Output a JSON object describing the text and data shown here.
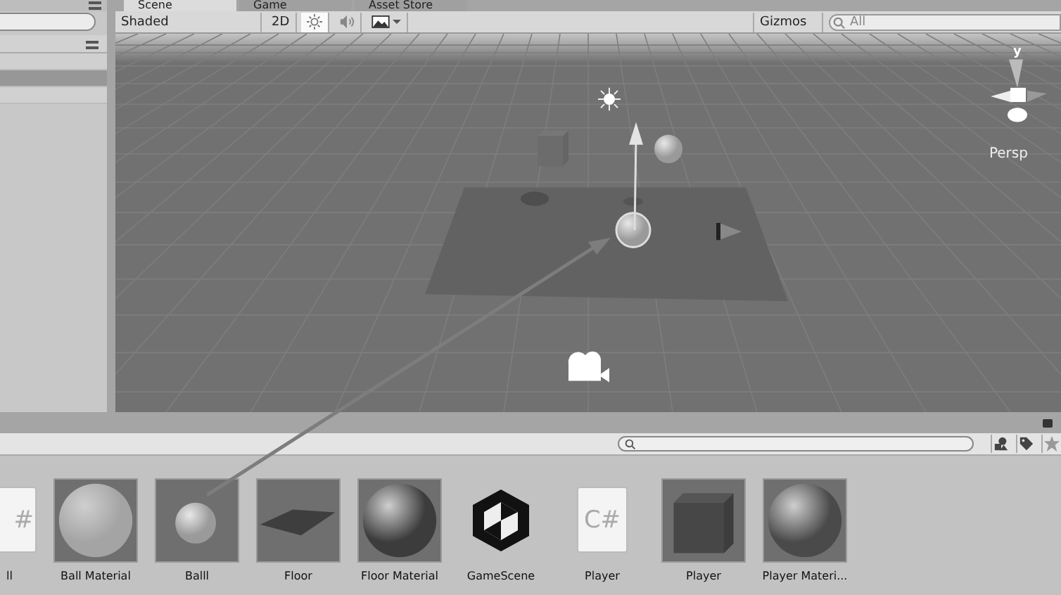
{
  "hierarchy": {
    "rows": [
      {
        "selected": false
      },
      {
        "selected": true
      },
      {
        "selected": false
      }
    ]
  },
  "tabs": [
    {
      "label": "Scene",
      "selected": true
    },
    {
      "label": "Game",
      "selected": false
    },
    {
      "label": "Asset Store",
      "selected": false
    }
  ],
  "scene_toolbar": {
    "shading": "Shaded",
    "mode_2d": {
      "label": "2D",
      "on": false
    },
    "lighting": {
      "on": true
    },
    "audio": {
      "on": false
    },
    "gizmos": "Gizmos",
    "search": {
      "placeholder": "All"
    }
  },
  "scene": {
    "axis_label": "y",
    "projection": "Persp"
  },
  "project": {
    "assets": [
      {
        "kind": "script",
        "name": "ll",
        "icon_text": "#"
      },
      {
        "kind": "material",
        "name": "Ball Material",
        "color": "#a4a4a4"
      },
      {
        "kind": "sphere",
        "name": "Balll"
      },
      {
        "kind": "plane",
        "name": "Floor"
      },
      {
        "kind": "material",
        "name": "Floor Material",
        "color": "#3c3c3c"
      },
      {
        "kind": "scene",
        "name": "GameScene"
      },
      {
        "kind": "script",
        "name": "Player",
        "icon_text": "C#"
      },
      {
        "kind": "cube",
        "name": "Player"
      },
      {
        "kind": "material",
        "name": "Player Materi...",
        "color": "#4a4a4a"
      }
    ]
  }
}
